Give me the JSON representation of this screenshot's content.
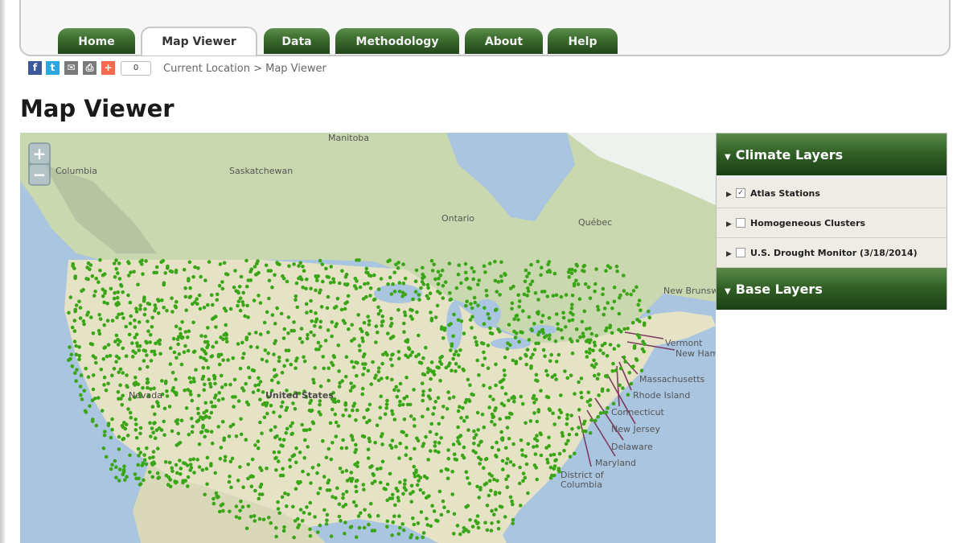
{
  "tabs": [
    {
      "label": "Home",
      "active": false
    },
    {
      "label": "Map Viewer",
      "active": true
    },
    {
      "label": "Data",
      "active": false
    },
    {
      "label": "Methodology",
      "active": false
    },
    {
      "label": "About",
      "active": false
    },
    {
      "label": "Help",
      "active": false
    }
  ],
  "share": {
    "icons": [
      "facebook-icon",
      "twitter-icon",
      "email-icon",
      "print-icon",
      "addthis-icon"
    ],
    "count": "0"
  },
  "breadcrumb": "Current Location > Map Viewer",
  "page_title": "Map Viewer",
  "map": {
    "zoom_in": "+",
    "zoom_out": "−",
    "place_labels": {
      "manitoba": "Manitoba",
      "saskatchewan": "Saskatchewan",
      "columbia": "Columbia",
      "ontario": "Ontario",
      "quebec": "Québec",
      "new_brunswick": "New Brunswick",
      "nevada": "Nevada",
      "united_states": "United States"
    },
    "callout_labels": {
      "vermont": "Vermont",
      "new_hampshire": "New Hampshire",
      "massachusetts": "Massachusetts",
      "rhode_island": "Rhode Island",
      "connecticut": "Connecticut",
      "new_jersey": "New Jersey",
      "delaware": "Delaware",
      "maryland": "Maryland",
      "district_of_columbia": "District of Columbia"
    },
    "station_color": "#3aa617"
  },
  "layers_panel": {
    "climate_header": "Climate Layers",
    "items": [
      {
        "label": "Atlas Stations",
        "checked": true
      },
      {
        "label": "Homogeneous Clusters",
        "checked": false
      },
      {
        "label": "U.S. Drought Monitor (3/18/2014)",
        "checked": false
      }
    ],
    "base_header": "Base Layers"
  },
  "colors": {
    "tab_green": "#3a6a2c",
    "water": "#a9c5e0",
    "land": "#e6e2c6",
    "canada": "#c9d8ae"
  }
}
